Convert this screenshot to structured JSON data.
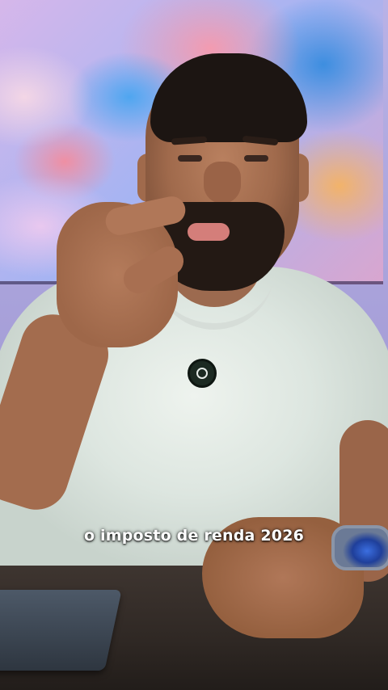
{
  "video": {
    "caption": "o imposto de renda 2026",
    "colors": {
      "caption_text": "#ffffff",
      "shirt": "#e4ebe6",
      "wall": "#b1aadf",
      "desk": "#2f2824"
    }
  }
}
